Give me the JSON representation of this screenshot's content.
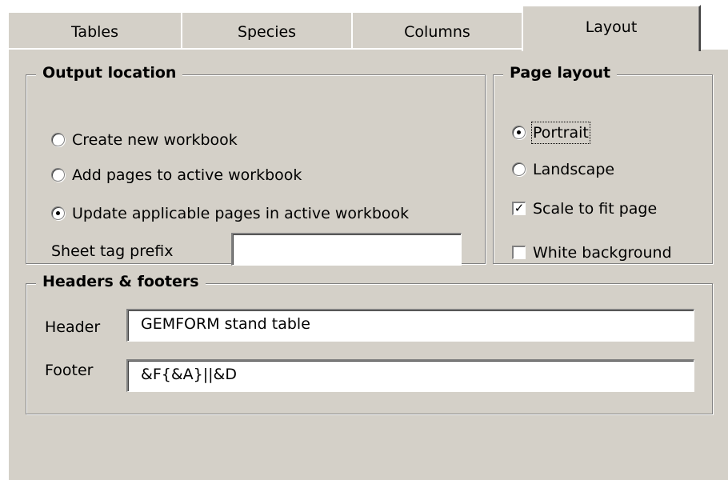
{
  "tabs": [
    {
      "label": "Tables"
    },
    {
      "label": "Species"
    },
    {
      "label": "Columns"
    },
    {
      "label": "Layout",
      "active": true
    }
  ],
  "output_location": {
    "title": "Output location",
    "options": [
      {
        "label": "Create new workbook",
        "selected": false
      },
      {
        "label": "Add pages to active workbook",
        "selected": false
      },
      {
        "label": "Update applicable pages in active workbook",
        "selected": true
      }
    ],
    "sheet_tag_prefix_label": "Sheet tag prefix",
    "sheet_tag_prefix_value": ""
  },
  "page_layout": {
    "title": "Page layout",
    "orientation": [
      {
        "label": "Portrait",
        "selected": true
      },
      {
        "label": "Landscape",
        "selected": false
      }
    ],
    "scale_to_fit": {
      "label": "Scale to fit page",
      "checked": true
    },
    "white_background": {
      "label": "White background",
      "checked": false
    }
  },
  "headers_footers": {
    "title": "Headers & footers",
    "header_label": "Header",
    "header_value": "GEMFORM stand table",
    "footer_label": "Footer",
    "footer_value": "&F{&A}||&D"
  },
  "colors": {
    "face": "#d4d0c8",
    "highlight": "#ffffff",
    "shadow": "#808080"
  }
}
